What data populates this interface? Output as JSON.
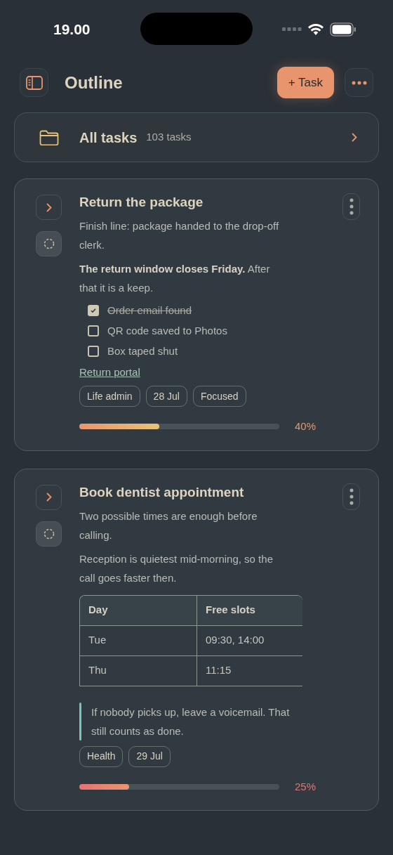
{
  "status_bar": {
    "time": "19.00"
  },
  "header": {
    "title": "Outline",
    "add_button": "+ Task"
  },
  "all_tasks": {
    "label": "All tasks",
    "count": "103 tasks"
  },
  "tasks": [
    {
      "title": "Return the package",
      "color": "#e8956e",
      "blocks": [
        {
          "kind": "paragraph",
          "text": "Finish line: package handed to the drop-off clerk."
        },
        {
          "kind": "paragraph",
          "text": "**The return window closes Friday.** After that it is a keep."
        },
        {
          "kind": "checklist",
          "items": [
            {
              "label": "Order email found",
              "checked": true
            },
            {
              "label": "QR code saved to Photos",
              "checked": false
            },
            {
              "label": "Box taped shut",
              "checked": false
            }
          ]
        },
        {
          "kind": "link",
          "text": "Return portal"
        }
      ],
      "tags": [
        "Life admin",
        "28 Jul",
        "Focused"
      ],
      "progress": {
        "level": 0.4,
        "reading": "40%"
      }
    },
    {
      "title": "Book dentist appointment",
      "color": "#e57373",
      "blocks": [
        {
          "kind": "paragraph",
          "text": "Two possible times are enough before calling."
        },
        {
          "kind": "paragraph",
          "text": "Reception is quietest mid-morning, so the call goes faster then."
        },
        {
          "kind": "table",
          "columns": [
            "Day",
            "Free slots"
          ],
          "rows": [
            [
              "Tue",
              "09:30, 14:00"
            ],
            [
              "Thu",
              "11:15"
            ]
          ]
        },
        {
          "kind": "quote",
          "text": "If nobody picks up, leave a voicemail. That still counts as done."
        }
      ],
      "tags": [
        "Health",
        "29 Jul"
      ],
      "progress": {
        "level": 0.25,
        "reading": "25%"
      }
    }
  ]
}
